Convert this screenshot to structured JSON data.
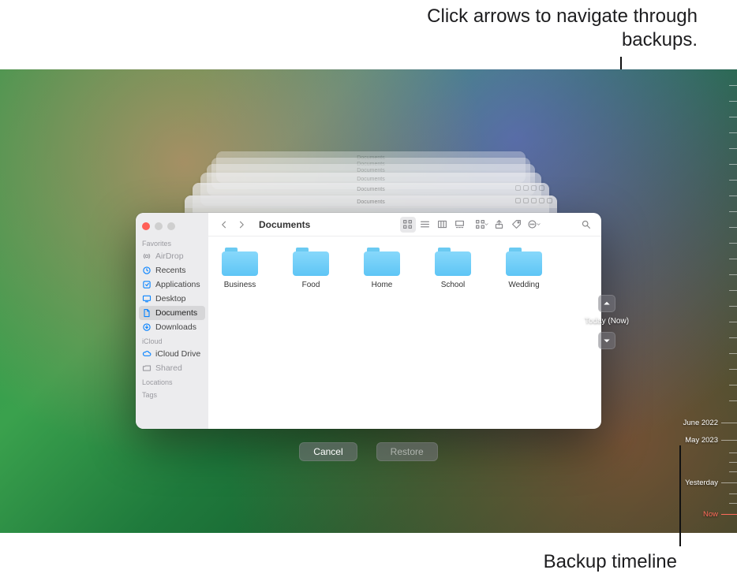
{
  "callouts": {
    "top": "Click arrows to navigate through backups.",
    "bottom": "Backup timeline"
  },
  "time_machine": {
    "current_label": "Today (Now)",
    "actions": {
      "cancel": "Cancel",
      "restore": "Restore"
    },
    "timeline": [
      {
        "label": "June 2022"
      },
      {
        "label": "May 2023"
      },
      {
        "label": "Yesterday"
      },
      {
        "label": "Now",
        "now": true
      }
    ]
  },
  "finder": {
    "title": "Documents",
    "sidebar": {
      "sections": {
        "favorites": {
          "header": "Favorites",
          "items": [
            {
              "name": "AirDrop",
              "sel": false
            },
            {
              "name": "Recents",
              "sel": false
            },
            {
              "name": "Applications",
              "sel": false
            },
            {
              "name": "Desktop",
              "sel": false
            },
            {
              "name": "Documents",
              "sel": true
            },
            {
              "name": "Downloads",
              "sel": false
            }
          ]
        },
        "icloud": {
          "header": "iCloud",
          "items": [
            {
              "name": "iCloud Drive"
            },
            {
              "name": "Shared"
            }
          ]
        },
        "locations": {
          "header": "Locations"
        },
        "tags": {
          "header": "Tags"
        }
      }
    },
    "folders": [
      {
        "name": "Business"
      },
      {
        "name": "Food"
      },
      {
        "name": "Home"
      },
      {
        "name": "School"
      },
      {
        "name": "Wedding"
      }
    ]
  }
}
